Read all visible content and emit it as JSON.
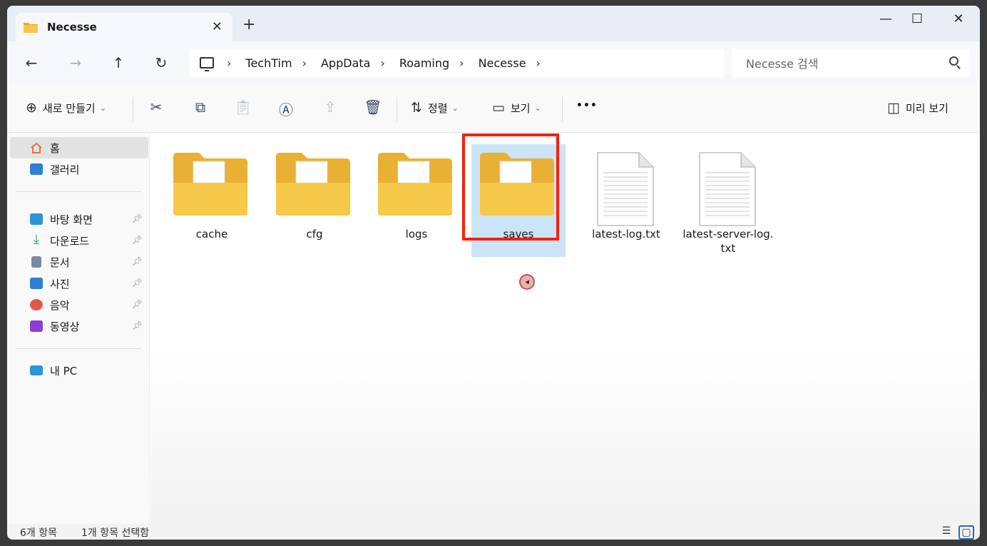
{
  "tab": {
    "title": "Necesse",
    "close": "✕",
    "new_tab": "+"
  },
  "window_controls": {
    "minimize": "—",
    "maximize": "☐",
    "close": "✕"
  },
  "nav": {
    "back": "←",
    "forward": "→",
    "up": "↑",
    "refresh": "↻"
  },
  "address": {
    "crumbs": [
      "TechTim",
      "AppData",
      "Roaming",
      "Necesse"
    ],
    "sep": "›"
  },
  "search": {
    "placeholder": "Necesse 검색"
  },
  "command_bar": {
    "new_label": "새로 만들기",
    "sort_label": "정렬",
    "view_label": "보기",
    "more": "•••",
    "preview_label": "미리 보기",
    "icons": [
      "cut-icon",
      "copy-icon",
      "paste-icon",
      "rename-icon",
      "share-icon",
      "delete-icon"
    ]
  },
  "sidebar": {
    "items": [
      {
        "label": "홈",
        "icon": "home-icon",
        "color": "#e8743b",
        "selected": true
      },
      {
        "label": "갤러리",
        "icon": "gallery-icon",
        "color": "#2f7fd8"
      },
      {
        "label": "바탕 화면",
        "icon": "desktop-icon",
        "color": "#2a96d8",
        "pinned": true
      },
      {
        "label": "다운로드",
        "icon": "download-icon",
        "color": "#1b9e5b",
        "pinned": true
      },
      {
        "label": "문서",
        "icon": "documents-icon",
        "color": "#7a8aa0",
        "pinned": true
      },
      {
        "label": "사진",
        "icon": "pictures-icon",
        "color": "#2f7fd8",
        "pinned": true
      },
      {
        "label": "음악",
        "icon": "music-icon",
        "color": "#e0584a",
        "pinned": true
      },
      {
        "label": "동영상",
        "icon": "videos-icon",
        "color": "#8a3fd1",
        "pinned": true
      },
      {
        "label": "내 PC",
        "icon": "this-pc-icon",
        "color": "#2a96d8"
      }
    ]
  },
  "files": [
    {
      "name": "cache",
      "type": "folder"
    },
    {
      "name": "cfg",
      "type": "folder"
    },
    {
      "name": "logs",
      "type": "folder"
    },
    {
      "name": "saves",
      "type": "folder",
      "selected": true
    },
    {
      "name": "latest-log.txt",
      "type": "text"
    },
    {
      "name": "latest-server-log.\ntxt",
      "type": "text"
    }
  ],
  "status": {
    "count": "6개 항목",
    "selected": "1개 항목 선택함"
  },
  "colors": {
    "highlight": "#ff1c0d",
    "selection": "#cce4f7",
    "folder": "#f5c344"
  }
}
